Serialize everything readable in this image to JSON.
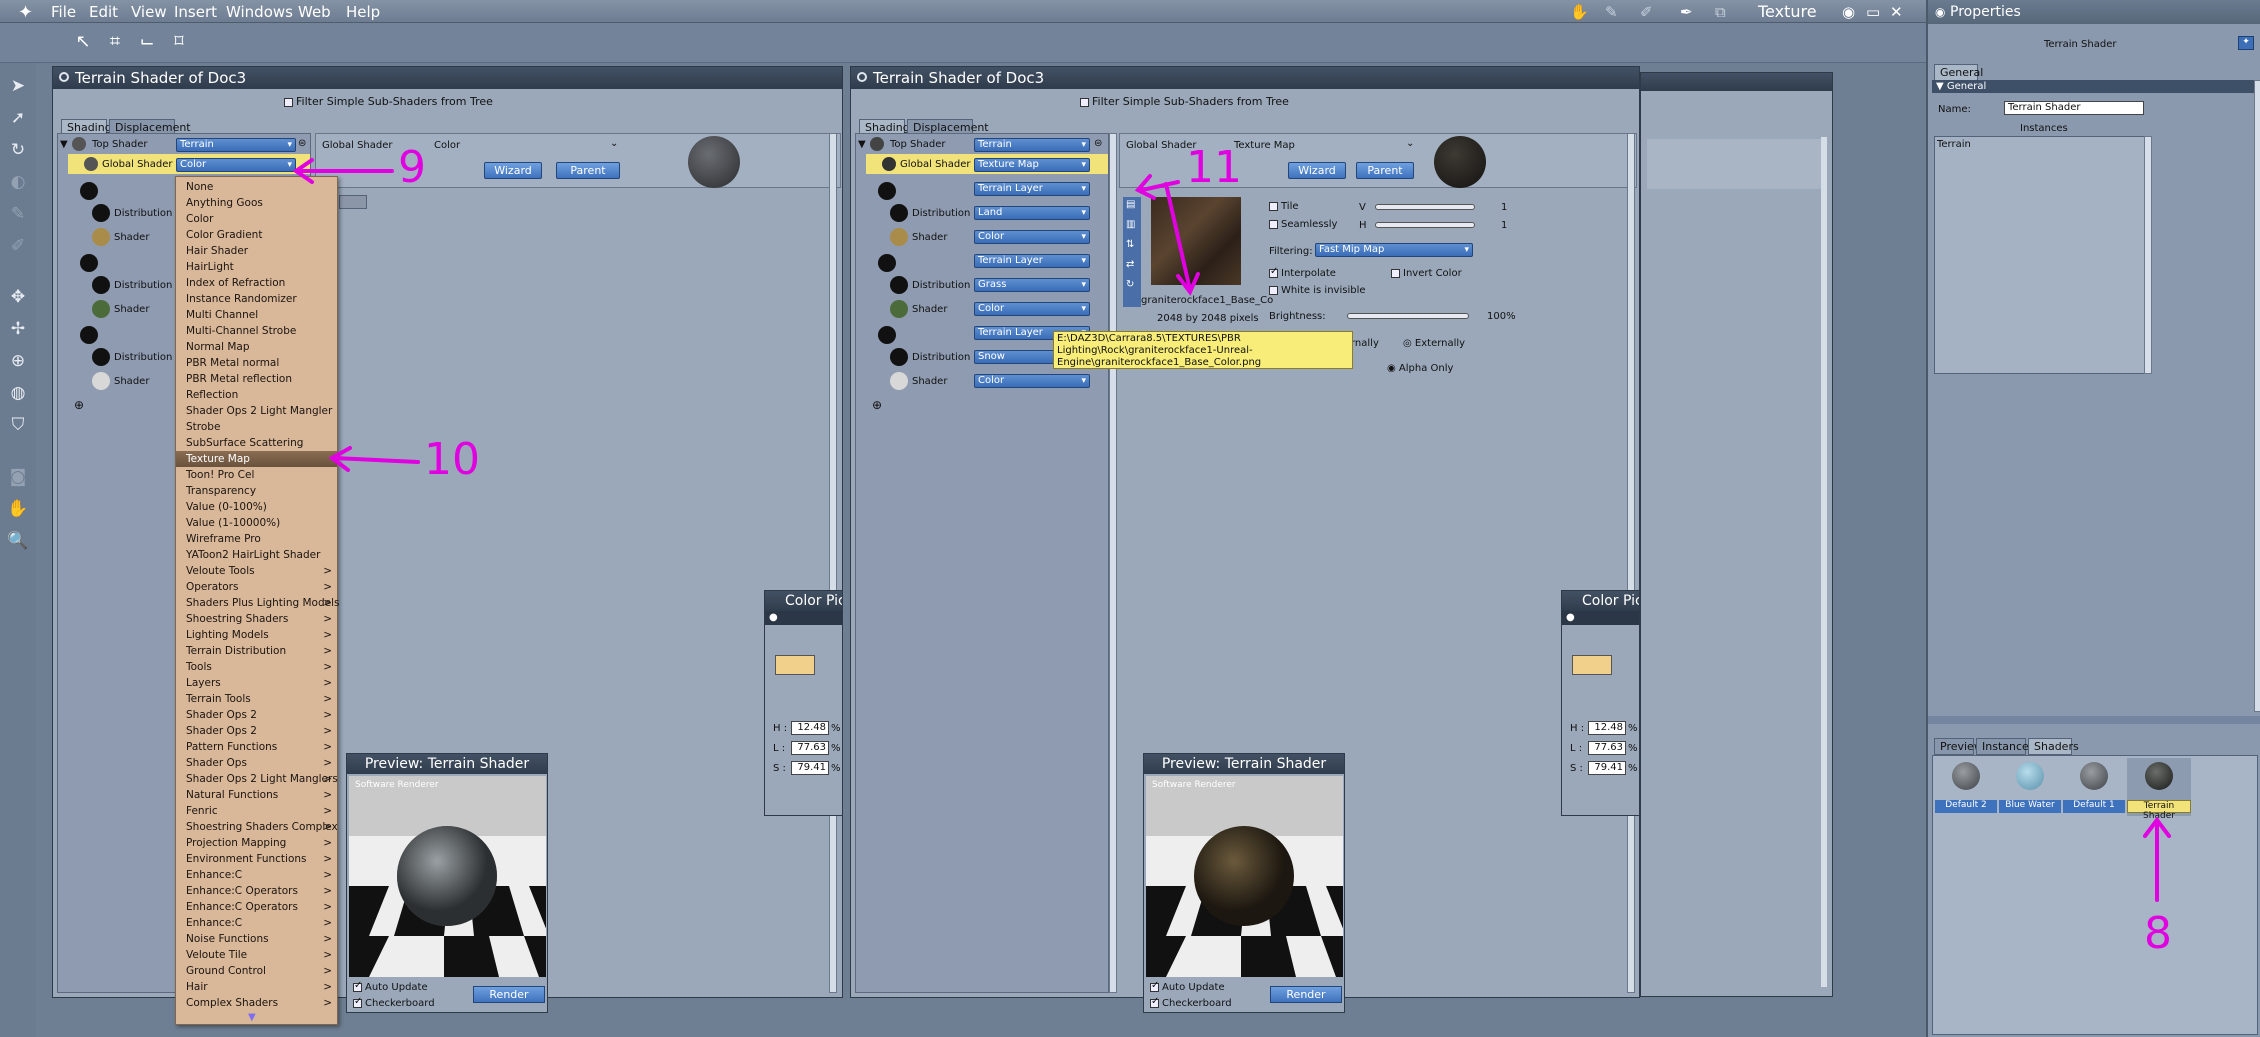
{
  "menubar": {
    "items": [
      "File",
      "Edit",
      "View",
      "Insert",
      "Windows",
      "Web",
      "Help"
    ],
    "room_title": "Texture"
  },
  "windows": [
    {
      "title": "Terrain Shader of Doc3",
      "filter_label": "Filter Simple Sub-Shaders from Tree",
      "tabs": [
        "Shading",
        "Displacement"
      ],
      "tree": {
        "top_shader": "Top Shader",
        "top_value": "Terrain",
        "global_shader": "Global Shader",
        "global_value": "Color",
        "distribution": "Distribution",
        "shader": "Shader"
      },
      "header": {
        "left": "Global Shader",
        "right": "Color",
        "wizard": "Wizard",
        "parent": "Parent"
      }
    },
    {
      "title": "Terrain Shader of Doc3",
      "filter_label": "Filter Simple Sub-Shaders from Tree",
      "tabs": [
        "Shading",
        "Displacement"
      ],
      "tree": {
        "top_shader": "Top Shader",
        "top_value": "Terrain",
        "global_shader": "Global Shader",
        "global_value": "Texture Map",
        "distribution": "Distribution",
        "shader": "Shader",
        "layers": [
          {
            "layer": "Terrain Layer",
            "dist": "Land",
            "shader": "Color"
          },
          {
            "layer": "Terrain Layer",
            "dist": "Grass",
            "shader": "Color"
          },
          {
            "layer": "Terrain Layer",
            "dist": "Snow",
            "shader": "Color"
          }
        ]
      },
      "header": {
        "left": "Global Shader",
        "right": "Texture Map",
        "wizard": "Wizard",
        "parent": "Parent"
      },
      "texture": {
        "tile": "Tile",
        "seamlessly": "Seamlessly",
        "v": "V",
        "h": "H",
        "v_val": "1",
        "h_val": "1",
        "filtering": "Filtering:",
        "filter_value": "Fast Mip Map",
        "interpolate": "Interpolate",
        "invert": "Invert Color",
        "white_invisible": "White is invisible",
        "filename": "graniterockface1_Base_Co",
        "size": "2048 by 2048 pixels",
        "brightness": "Brightness:",
        "brightness_val": "100%",
        "internally": "rnally",
        "externally": "Externally",
        "alpha_only": "Alpha Only",
        "tooltip": "E:\\DAZ3D\\Carrara8.5\\TEXTURES\\PBR Lighting\\Rock\\graniterockface1-Unreal-Engine\\graniterockface1_Base_Color.png"
      }
    }
  ],
  "dropdown_menu": {
    "items": [
      "None",
      "Anything Goos",
      "Color",
      "Color Gradient",
      "Hair Shader",
      "HairLight",
      "Index of Refraction",
      "Instance Randomizer",
      "Multi Channel",
      "Multi-Channel Strobe",
      "Normal Map",
      "PBR Metal normal",
      "PBR Metal reflection",
      "Reflection",
      "Shader Ops 2 Light Mangler",
      "Strobe",
      "SubSurface Scattering",
      "Texture Map",
      "Toon! Pro Cel",
      "Transparency",
      "Value (0-100%)",
      "Value (1-10000%)",
      "Wireframe Pro",
      "YAToon2 HairLight Shader"
    ],
    "submenus": [
      "Veloute Tools",
      "Operators",
      "Shaders Plus Lighting Models",
      "Shoestring Shaders",
      "Lighting Models",
      "Terrain Distribution",
      "Tools",
      "Layers",
      "Terrain Tools",
      "Shader Ops 2",
      "Shader Ops 2",
      "Pattern Functions",
      "Shader Ops",
      "Shader Ops 2 Light Manglers",
      "Natural Functions",
      "Fenric",
      "Shoestring Shaders Complex",
      "Projection Mapping",
      "Environment Functions",
      "Enhance:C",
      "Enhance:C Operators",
      "Enhance:C Operators",
      "Enhance:C",
      "Noise Functions",
      "Veloute Tile",
      "Ground Control",
      "Hair",
      "Complex Shaders"
    ],
    "selected": "Texture Map"
  },
  "color_picker": {
    "title": "Color Pic",
    "h_label": "H :",
    "l_label": "L :",
    "s_label": "S :",
    "h": "12.48",
    "l": "77.63",
    "s": "79.41",
    "pct": "%",
    "swatch": "#f0d08a"
  },
  "preview": {
    "title": "Preview: Terrain Shader",
    "auto_update": "Auto Update",
    "checkerboard": "Checkerboard",
    "render": "Render",
    "overlay": "Software Renderer"
  },
  "properties": {
    "title": "Properties",
    "shader_name": "Terrain Shader",
    "tab": "General",
    "section": "General",
    "name_label": "Name:",
    "name_value": "Terrain Shader",
    "instances_label": "Instances",
    "instances": [
      "Terrain"
    ],
    "bottom_tabs": [
      "Preview",
      "Instances",
      "Shaders"
    ],
    "shaders": [
      {
        "name": "Default 2",
        "color": "#5d6166"
      },
      {
        "name": "Blue Water",
        "color": "#7fb6cf"
      },
      {
        "name": "Default 1",
        "color": "#5a5d62"
      },
      {
        "name": "Terrain Shader",
        "color": "#3a3d3a"
      }
    ]
  },
  "annotations": [
    "8",
    "9",
    "10",
    "11"
  ]
}
